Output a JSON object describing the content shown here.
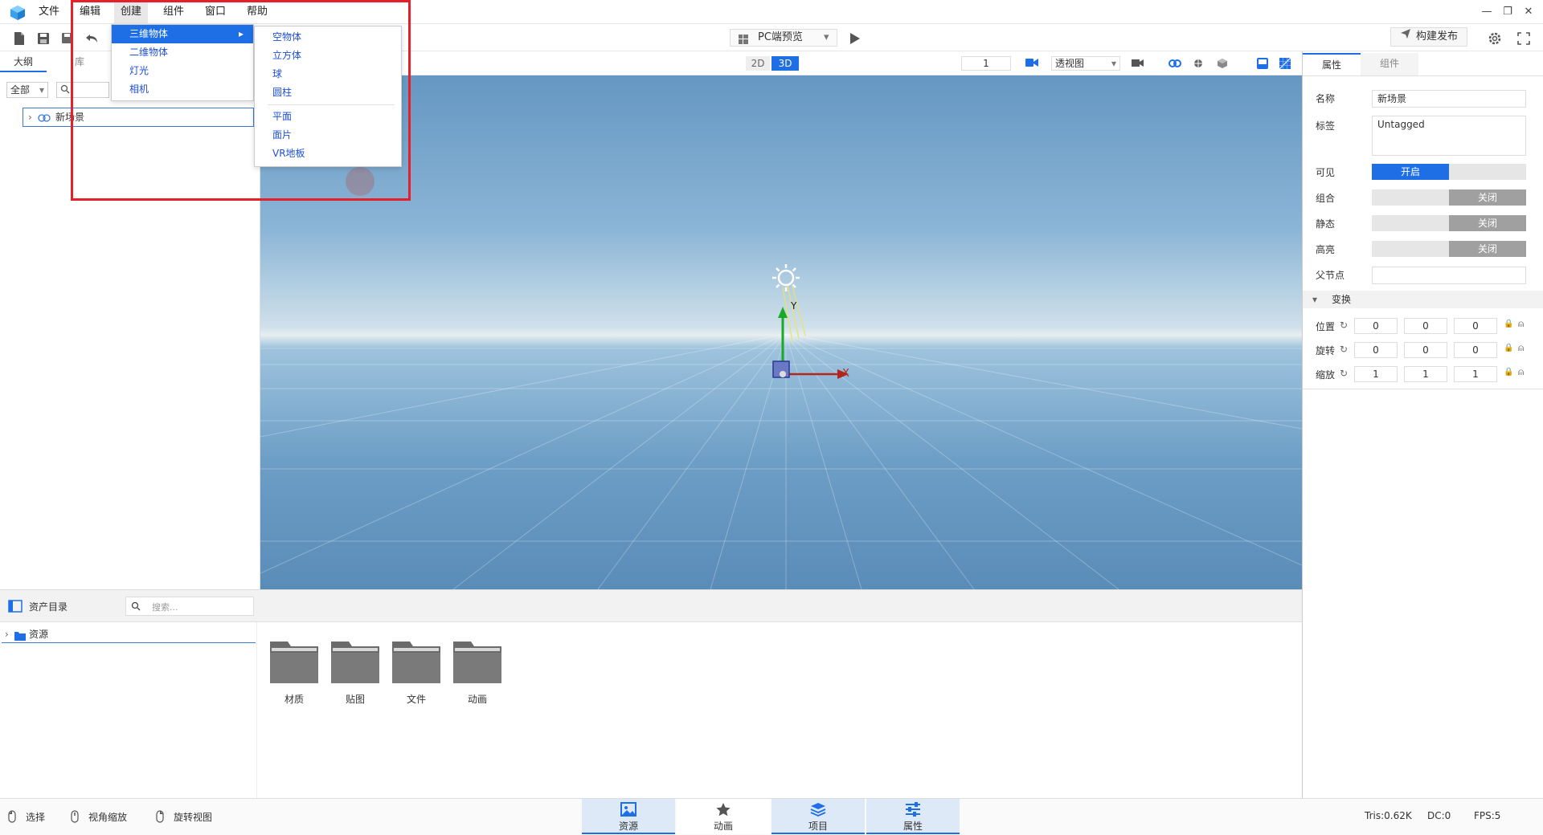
{
  "menubar": {
    "items": [
      "文件",
      "编辑",
      "创建",
      "组件",
      "窗口",
      "帮助"
    ],
    "active": "创建"
  },
  "toolbar": {
    "preview_label": "PC端预览",
    "publish_label": "构建发布"
  },
  "create_menu": {
    "items": [
      "三维物体",
      "二维物体",
      "灯光",
      "相机"
    ],
    "highlighted": "三维物体",
    "submenu": [
      "空物体",
      "立方体",
      "球",
      "圆柱",
      "平面",
      "面片",
      "VR地板"
    ]
  },
  "left_panel": {
    "tabs": [
      "大纲",
      "库"
    ],
    "filter_value": "全部",
    "tree_item": "新场景"
  },
  "viewport_toolbar": {
    "mode_2d": "2D",
    "mode_3d": "3D",
    "camera_index": "1",
    "view_mode": "透视图"
  },
  "gizmo": {
    "y_label": "Y",
    "x_label": "X"
  },
  "properties": {
    "tabs": [
      "属性",
      "组件"
    ],
    "name_label": "名称",
    "name_value": "新场景",
    "tag_label": "标签",
    "tag_value": "Untagged",
    "visible_label": "可见",
    "visible_value": "开启",
    "group_label": "组合",
    "group_value": "关闭",
    "static_label": "静态",
    "static_value": "关闭",
    "highlight_label": "高亮",
    "highlight_value": "关闭",
    "parent_label": "父节点",
    "transform_title": "变换",
    "position_label": "位置",
    "position": [
      "0",
      "0",
      "0"
    ],
    "rotation_label": "旋转",
    "rotation": [
      "0",
      "0",
      "0"
    ],
    "scale_label": "缩放",
    "scale": [
      "1",
      "1",
      "1"
    ]
  },
  "assets": {
    "title": "资产目录",
    "search_placeholder": "搜索...",
    "tree_root": "资源",
    "folders": [
      "材质",
      "贴图",
      "文件",
      "动画"
    ]
  },
  "statusbar": {
    "hints": [
      "选择",
      "视角缩放",
      "旋转视图"
    ],
    "tabs": [
      "资源",
      "动画",
      "项目",
      "属性"
    ],
    "tris": "Tris:0.62K",
    "dc": "DC:0",
    "fps": "FPS:5"
  },
  "colors": {
    "accent": "#1e6fe6",
    "highlight_red": "#e5202a",
    "sky_top": "#6597c2",
    "ground": "#5a8cb8"
  }
}
